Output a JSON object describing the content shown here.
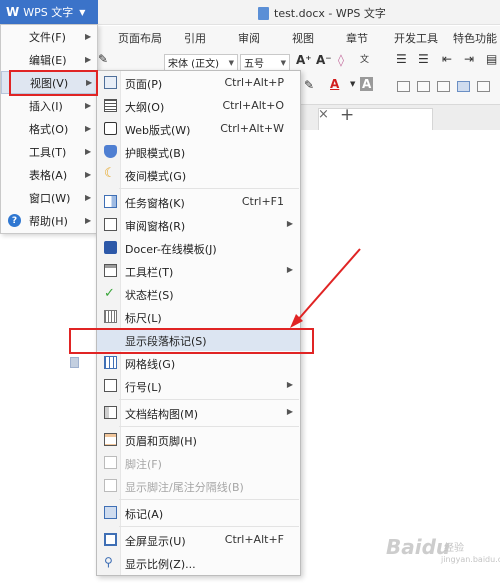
{
  "app": {
    "logo_label": "WPS 文字",
    "window_title": "test.docx - WPS 文字"
  },
  "ribbon_tabs": [
    "页面布局",
    "引用",
    "审阅",
    "视图",
    "章节",
    "开发工具",
    "特色功能"
  ],
  "toolbar": {
    "font_name": "宋体 (正文)",
    "font_size": "五号",
    "font_color_label": "A",
    "char_shade_label": "A"
  },
  "main_menu": {
    "items": [
      {
        "label": "文件(F)",
        "has_submenu": true
      },
      {
        "label": "编辑(E)",
        "has_submenu": true
      },
      {
        "label": "视图(V)",
        "has_submenu": true,
        "selected": true
      },
      {
        "label": "插入(I)",
        "has_submenu": true
      },
      {
        "label": "格式(O)",
        "has_submenu": true
      },
      {
        "label": "工具(T)",
        "has_submenu": true
      },
      {
        "label": "表格(A)",
        "has_submenu": true
      },
      {
        "label": "窗口(W)",
        "has_submenu": true
      },
      {
        "label": "帮助(H)",
        "has_submenu": true
      }
    ]
  },
  "view_menu": {
    "items": [
      {
        "label": "页面(P)",
        "shortcut": "Ctrl+Alt+P",
        "icon": "page-view-icon"
      },
      {
        "label": "大纲(O)",
        "shortcut": "Ctrl+Alt+O",
        "icon": "outline-view-icon"
      },
      {
        "label": "Web版式(W)",
        "shortcut": "Ctrl+Alt+W",
        "icon": "web-layout-icon"
      },
      {
        "label": "护眼模式(B)",
        "shortcut": "",
        "icon": "eye-protection-icon"
      },
      {
        "label": "夜间模式(G)",
        "shortcut": "",
        "icon": "night-mode-icon"
      },
      {
        "label": "任务窗格(K)",
        "shortcut": "Ctrl+F1",
        "icon": "task-pane-icon"
      },
      {
        "label": "审阅窗格(R)",
        "shortcut": "",
        "icon": "review-pane-icon",
        "has_submenu": true
      },
      {
        "label": "Docer-在线模板(J)",
        "shortcut": "",
        "icon": "docer-template-icon"
      },
      {
        "label": "工具栏(T)",
        "shortcut": "",
        "icon": "toolbar-icon",
        "has_submenu": true
      },
      {
        "label": "状态栏(S)",
        "shortcut": "",
        "icon": "checkmark-icon"
      },
      {
        "label": "标尺(L)",
        "shortcut": "",
        "icon": "ruler-icon"
      },
      {
        "label": "显示段落标记(S)",
        "shortcut": "",
        "icon": "",
        "highlighted": true
      },
      {
        "label": "网格线(G)",
        "shortcut": "",
        "icon": "gridlines-icon"
      },
      {
        "label": "行号(L)",
        "shortcut": "",
        "icon": "line-numbers-icon",
        "has_submenu": true
      },
      {
        "label": "文档结构图(M)",
        "shortcut": "",
        "icon": "document-map-icon",
        "has_submenu": true
      },
      {
        "label": "页眉和页脚(H)",
        "shortcut": "",
        "icon": "header-footer-icon"
      },
      {
        "label": "脚注(F)",
        "shortcut": "",
        "icon": "footnote-icon",
        "disabled": true
      },
      {
        "label": "显示脚注/尾注分隔线(B)",
        "shortcut": "",
        "icon": "footnote-separator-icon",
        "disabled": true
      },
      {
        "label": "标记(A)",
        "shortcut": "",
        "icon": "markup-icon"
      },
      {
        "label": "全屏显示(U)",
        "shortcut": "Ctrl+Alt+F",
        "icon": "fullscreen-icon"
      },
      {
        "label": "显示比例(Z)...",
        "shortcut": "",
        "icon": "zoom-icon"
      }
    ]
  },
  "watermark": {
    "logo": "Baidu",
    "text": "经验",
    "url": "jingyan.baidu.com"
  },
  "colors": {
    "accent": "#3b73c9",
    "highlight_box": "#e02424",
    "menu_hover": "#dce5f2"
  }
}
